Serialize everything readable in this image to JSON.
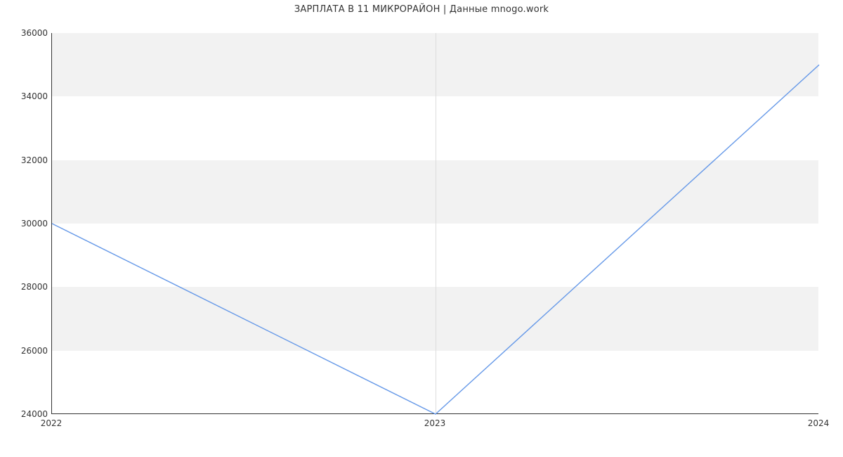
{
  "title": "ЗАРПЛАТА В   11 МИКРОРАЙОН | Данные mnogo.work",
  "y_ticks": [
    24000,
    26000,
    28000,
    30000,
    32000,
    34000,
    36000
  ],
  "x_ticks": [
    "2022",
    "2023",
    "2024"
  ],
  "chart_data": {
    "type": "line",
    "title": "ЗАРПЛАТА В   11 МИКРОРАЙОН | Данные mnogo.work",
    "xlabel": "",
    "ylabel": "",
    "x": [
      2022,
      2023,
      2024
    ],
    "categories": [
      "2022",
      "2023",
      "2024"
    ],
    "values": [
      30000,
      24000,
      35000
    ],
    "ylim": [
      24000,
      36000
    ],
    "xlim": [
      2022,
      2024
    ],
    "line_color": "#6699e8",
    "grid": {
      "horizontal_bands": true,
      "vertical": true
    }
  }
}
